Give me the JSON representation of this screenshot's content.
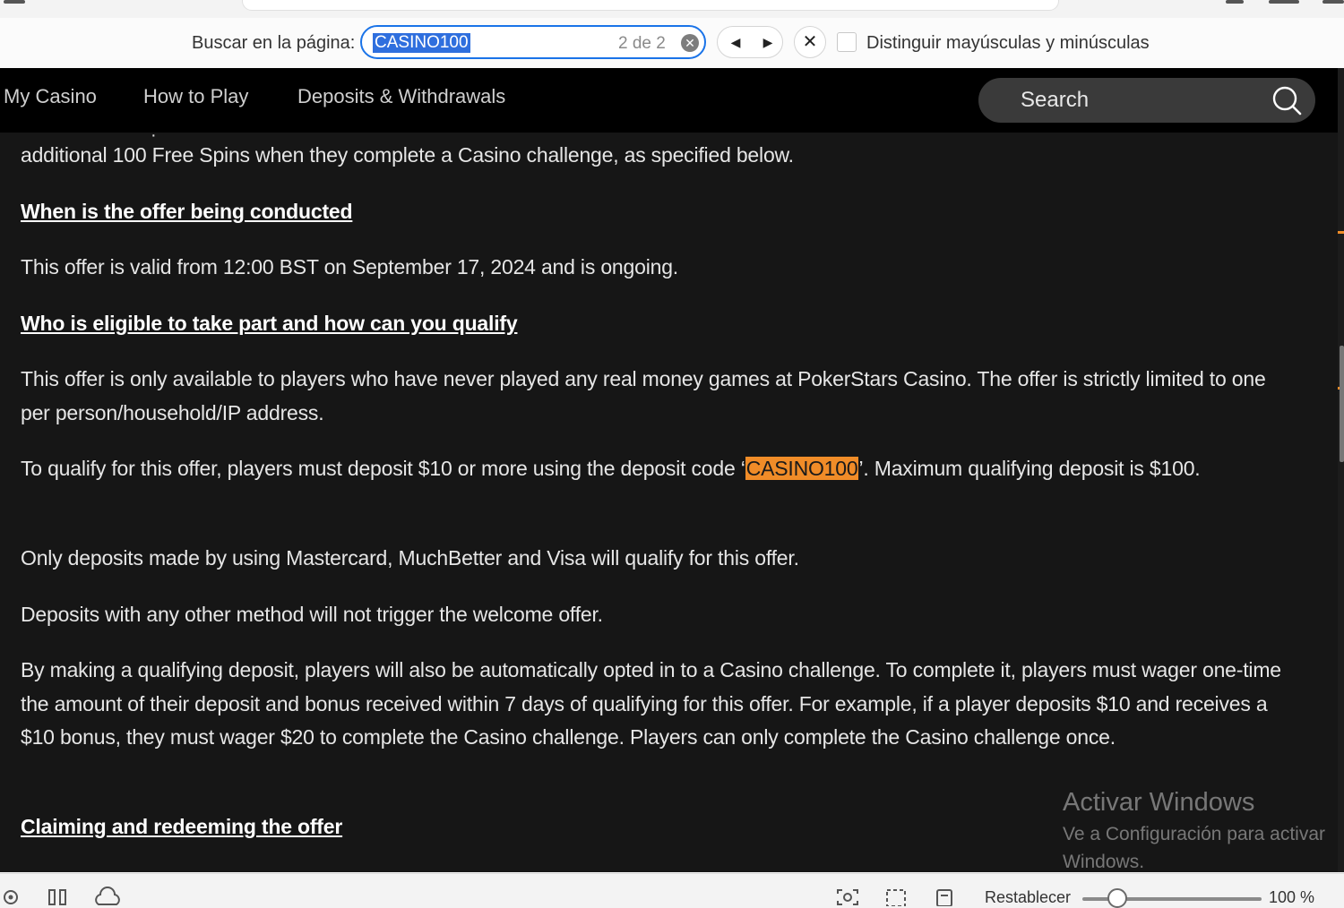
{
  "find_bar": {
    "label": "Buscar en la página:",
    "query": "CASINO100",
    "count": "2 de 2",
    "match_case_label": "Distinguir mayúsculas y minúsculas",
    "match_case_checked": false
  },
  "site_nav": {
    "links": [
      "My Casino",
      "How to Play",
      "Deposits & Withdrawals"
    ],
    "search_label": "Search"
  },
  "content": {
    "p1": "additional 100 Free Spins when they complete a Casino challenge, as specified below.",
    "h_when": "When is the offer being conducted",
    "p_when": "This offer is valid from 12:00 BST on September 17, 2024 and is ongoing.",
    "h_who": "Who is eligible to take part and how can you qualify",
    "p_who": "This offer is only available to players who have never played any real money games at PokerStars Casino. The offer is strictly limited to one per person/household/IP address.",
    "p_qualify_before": "To qualify for this offer, players must deposit $10 or more using the deposit code ‘",
    "p_qualify_code": "CASINO100",
    "p_qualify_after": "’. Maximum qualifying deposit is $100.",
    "p_methods": "Only deposits made by using Mastercard, MuchBetter and Visa will qualify for this offer.",
    "p_other": "Deposits with any other method will not trigger the welcome offer.",
    "p_challenge": "By making a qualifying deposit, players will also be automatically opted in to a Casino challenge. To complete it, players must wager one-time the amount of their deposit and bonus received within 7 days of qualifying for this offer. For example, if a player deposits $10 and receives a $10 bonus, they must wager $20 to complete the Casino challenge. Players can only complete the Casino challenge once.",
    "h_claim": "Claiming and redeeming the offer"
  },
  "watermark": {
    "title": "Activar Windows",
    "line1": "Ve a Configuración para activar",
    "line2": "Windows."
  },
  "status_bar": {
    "reset_label": "Restablecer",
    "zoom": "100 %",
    "zoom_fraction": 0.2
  },
  "colors": {
    "highlight": "#f08c28",
    "find_focus": "#1a73e8",
    "content_bg": "#161616",
    "nav_bg": "#000000"
  }
}
